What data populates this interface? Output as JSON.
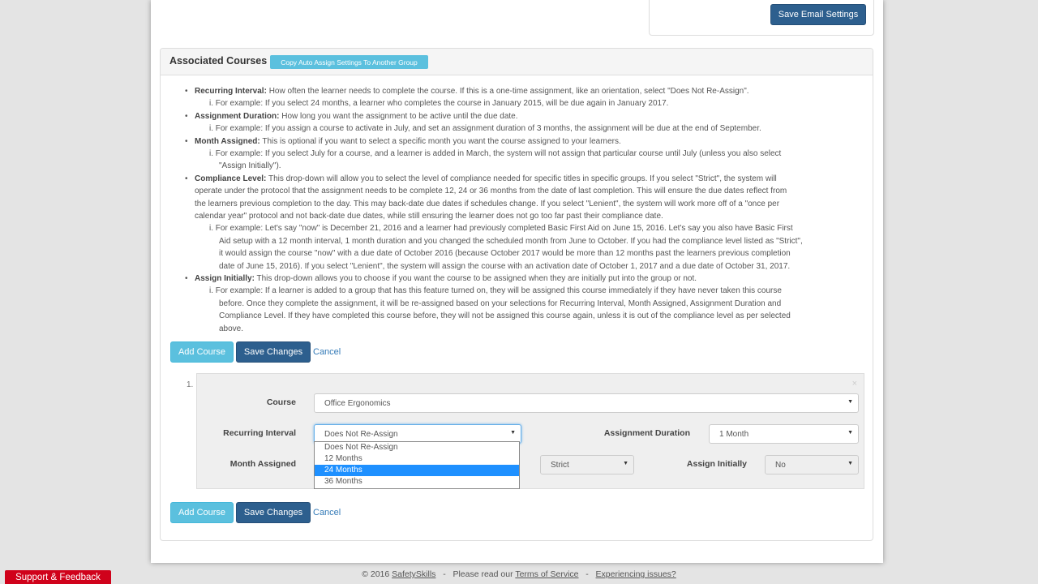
{
  "email": {
    "save_label": "Save Email Settings"
  },
  "associated": {
    "title": "Associated Courses",
    "copy_label": "Copy Auto Assign Settings To Another Group"
  },
  "help": [
    {
      "term": "Recurring Interval:",
      "text": " How often the learner needs to complete the course. If this is a one-time assignment, like an orientation, select \"Does Not Re-Assign\".",
      "example": "i. For example: If you select 24 months, a learner who completes the course in January 2015, will be due again in January 2017."
    },
    {
      "term": "Assignment Duration:",
      "text": " How long you want the assignment to be active until the due date.",
      "example": "i. For example: If you assign a course to activate in July, and set an assignment duration of 3 months, the assignment will be due at the end of September."
    },
    {
      "term": "Month Assigned:",
      "text": " This is optional if you want to select a specific month you want the course assigned to your learners.",
      "example_lines": [
        "i. For example: If you select July for a course, and a learner is added in March, the system will not assign that particular course until July (unless you also select",
        "\"Assign Initially\")."
      ]
    },
    {
      "term": "Compliance Level:",
      "text_lines": [
        " This drop-down will allow you to select the level of compliance needed for specific titles in specific groups. If you select \"Strict\", the system will",
        "operate under the protocol that the assignment needs to be complete 12, 24 or 36 months from the date of last completion. This will ensure the due dates reflect from",
        "the learners previous completion to the day. This may back-date due dates if schedules change. If you select \"Lenient\", the system will work more off of a \"once per",
        "calendar year\" protocol and not back-date due dates, while still ensuring the learner does not go too far past their compliance date."
      ],
      "example_lines": [
        "i. For example: Let's say \"now\" is December 21, 2016 and a learner had previously completed Basic First Aid on June 15, 2016. Let's say you also have Basic First",
        "Aid setup with a 12 month interval, 1 month duration and you changed the scheduled month from June to October. If you had the compliance level listed as \"Strict\",",
        "it would assign the course \"now\" with a due date of October 2016 (because October 2017 would be more than 12 months past the learners previous completion",
        "date of June 15, 2016). If you select \"Lenient\", the system will assign the course with an activation date of October 1, 2017 and a due date of October 31, 2017."
      ]
    },
    {
      "term": "Assign Initially:",
      "text": " This drop-down allows you to choose if you want the course to be assigned when they are initially put into the group or not.",
      "example_lines": [
        "i. For example: If a learner is added to a group that has this feature turned on, they will be assigned this course immediately if they have never taken this course",
        "before. Once they complete the assignment, it will be re-assigned based on your selections for Recurring Interval, Month Assigned, Assignment Duration and",
        "Compliance Level. If they have completed this course before, they will not be assigned this course again, unless it is out of the compliance level as per selected",
        "above."
      ]
    }
  ],
  "actions": {
    "add_course": "Add Course",
    "save_changes": "Save Changes",
    "cancel": "Cancel"
  },
  "course_item": {
    "number": "1.",
    "course_label": "Course",
    "course_value": "Office Ergonomics",
    "interval_label": "Recurring Interval",
    "interval_value": "Does Not Re-Assign",
    "duration_label": "Assignment Duration",
    "duration_value": "1 Month",
    "month_label": "Month Assigned",
    "compliance_value": "Strict",
    "initially_label": "Assign Initially",
    "initially_value": "No",
    "close": "×"
  },
  "interval_options": [
    "Does Not Re-Assign",
    "12 Months",
    "24 Months",
    "36 Months"
  ],
  "interval_highlighted": "24 Months",
  "footer": {
    "copyright": "© 2016",
    "brand": "SafetySkills",
    "sep": "-",
    "read": "Please read our",
    "terms": "Terms of Service",
    "issues": "Experiencing issues?"
  },
  "support": "Support & Feedback",
  "colors": {
    "primary": "#2d5f8e",
    "info": "#5bc0de",
    "highlight": "#1e90ff",
    "support": "#d0021b"
  }
}
